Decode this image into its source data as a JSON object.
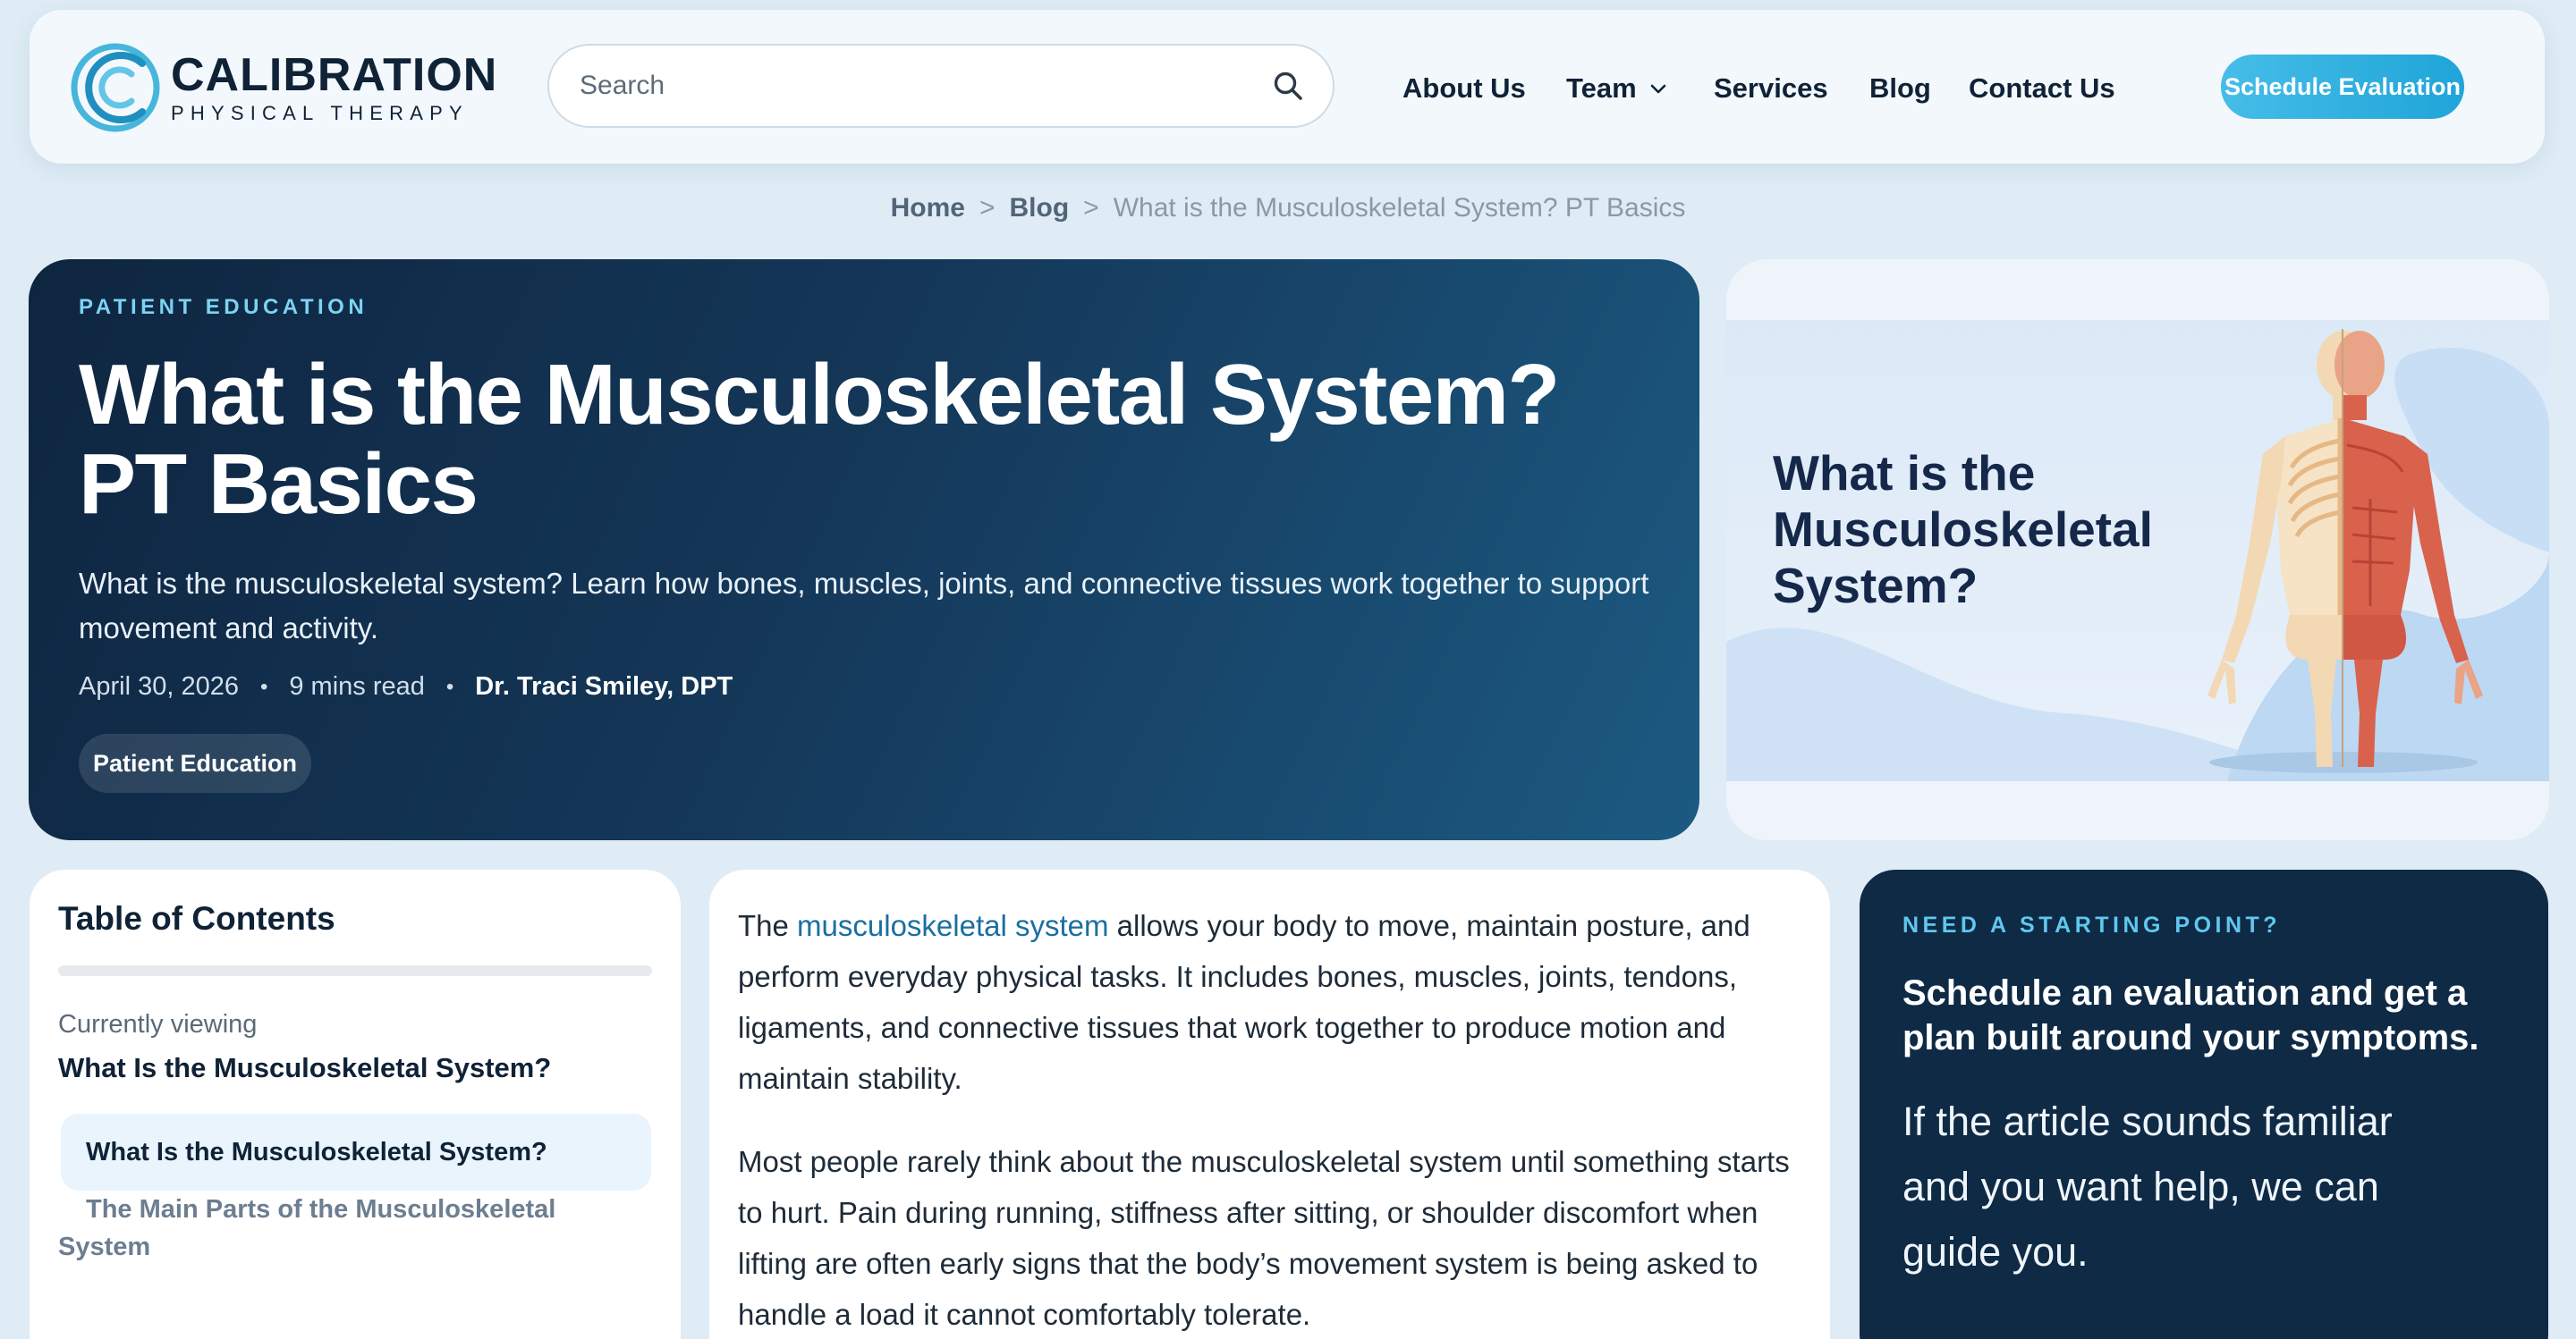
{
  "brand": {
    "name": "CALIBRATION",
    "tagline": "PHYSICAL THERAPY"
  },
  "search": {
    "placeholder": "Search",
    "icon": "search-icon"
  },
  "nav": {
    "about": "About Us",
    "team": "Team",
    "services": "Services",
    "blog": "Blog",
    "contact": "Contact Us",
    "cta": "Schedule Evaluation"
  },
  "breadcrumb": {
    "home": "Home",
    "blog": "Blog",
    "current": "What is the Musculoskeletal System? PT Basics",
    "separator": ">"
  },
  "hero": {
    "kicker": "PATIENT EDUCATION",
    "title_line1": "What is the Musculoskeletal System?",
    "title_line2": "PT Basics",
    "description": "What is the musculoskeletal system? Learn how bones, muscles, joints, and connective tissues work together to support movement and activity.",
    "date": "April 30, 2026",
    "read_time": "9 mins read",
    "author": "Dr. Traci Smiley, DPT",
    "tag": "Patient Education"
  },
  "image_card": {
    "heading": "What is the Musculoskeletal System?"
  },
  "toc": {
    "title": "Table of Contents",
    "current_label": "Currently viewing",
    "current_value": "What Is the Musculoskeletal System?",
    "items": [
      "What Is the Musculoskeletal System?",
      "The Main Parts of the Musculoskeletal System"
    ]
  },
  "article": {
    "p1_before": "The ",
    "p1_link": "musculoskeletal system",
    "p1_after": " allows your body to move, maintain posture, and perform everyday physical tasks. It includes bones, muscles, joints, tendons, ligaments, and connective tissues that work together to produce motion and maintain stability.",
    "p2": "Most people rarely think about the musculoskeletal system until something starts to hurt. Pain during running, stiffness after sitting, or shoulder discomfort when lifting are often early signs that the body’s movement system is being asked to handle a load it cannot comfortably tolerate."
  },
  "cta_card": {
    "kicker": "NEED A STARTING POINT?",
    "heading": "Schedule an evaluation and get a plan built around your symptoms.",
    "body": "If the article sounds familiar and you want help, we can guide you."
  },
  "colors": {
    "accent": "#1fa5d8",
    "navy": "#0f2236",
    "hero_start": "#0e2540",
    "hero_end": "#1c5a82",
    "link": "#1a6fa0"
  }
}
